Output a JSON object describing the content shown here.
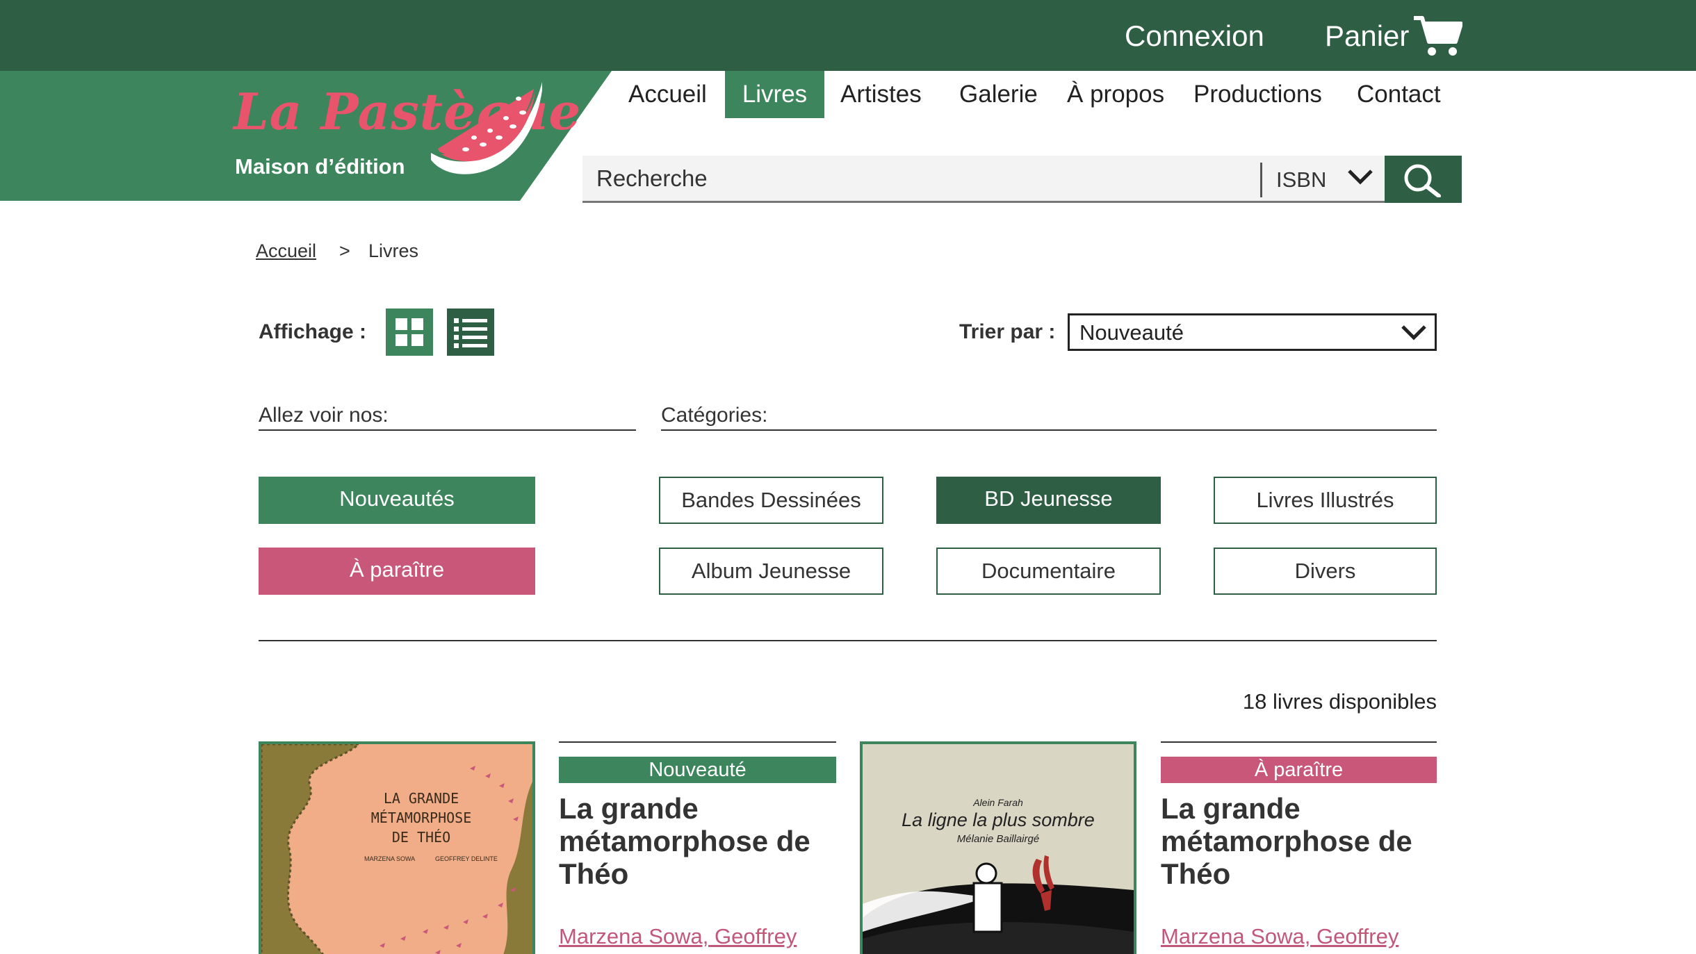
{
  "topbar": {
    "login": "Connexion",
    "cart": "Panier"
  },
  "brand": {
    "name": "La Pastèque",
    "tagline": "Maison d’édition"
  },
  "nav": [
    {
      "label": "Accueil"
    },
    {
      "label": "Livres"
    },
    {
      "label": "Artistes"
    },
    {
      "label": "Galerie"
    },
    {
      "label": "À propos"
    },
    {
      "label": "Productions"
    },
    {
      "label": "Contact"
    }
  ],
  "search": {
    "placeholder": "Recherche",
    "type": "ISBN"
  },
  "breadcrumb": {
    "home": "Accueil",
    "separator": ">",
    "current": "Livres"
  },
  "display": {
    "label": "Affichage :"
  },
  "sort": {
    "label": "Trier par :",
    "value": "Nouveauté"
  },
  "sections": {
    "see": "Allez voir nos:",
    "categories": "Catégories:"
  },
  "quick_filters": [
    {
      "label": "Nouveautés",
      "color": "#3d855c"
    },
    {
      "label": "À paraître",
      "color": "#c9577a"
    }
  ],
  "categories": [
    {
      "label": "Bandes Dessinées",
      "active": false
    },
    {
      "label": "BD Jeunesse",
      "active": true
    },
    {
      "label": "Livres Illustrés",
      "active": false
    },
    {
      "label": "Album Jeunesse",
      "active": false
    },
    {
      "label": "Documentaire",
      "active": false
    },
    {
      "label": "Divers",
      "active": false
    }
  ],
  "results": {
    "count_text": "18 livres disponibles"
  },
  "books": [
    {
      "badge": "Nouveauté",
      "badge_color": "#3d855c",
      "title": "La grande métamorphose de Théo",
      "author": "Marzena Sowa, Geoffrey",
      "cover": {
        "title_lines": [
          "LA GRANDE",
          "MÉTAMORPHOSE",
          "DE THÉO"
        ],
        "credit_left": "MARZENA SOWA",
        "credit_right": "GEOFFREY DELINTE"
      }
    },
    {
      "badge": "À paraître",
      "badge_color": "#c9577a",
      "title": "La grande métamorphose de Théo",
      "author": "Marzena Sowa, Geoffrey",
      "cover": {
        "author_top": "Alein Farah",
        "title": "La ligne la plus sombre",
        "illustrator": "Mélanie Baillairgé"
      }
    }
  ],
  "colors": {
    "dark_green": "#2e5e43",
    "green": "#3d855c",
    "pink": "#c9577a",
    "logo_pink": "#e8546c"
  }
}
